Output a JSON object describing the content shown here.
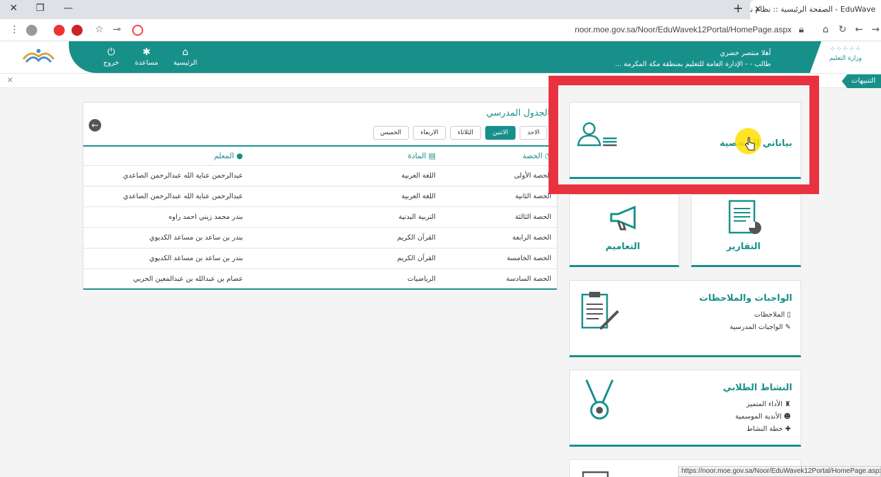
{
  "browser": {
    "tab_title": "EduWave - الصفحة الرئيسية :: نظام نور",
    "url": "noor.moe.gov.sa/Noor/EduWavek12Portal/HomePage.aspx",
    "status_url": "https://noor.moe.gov.sa/Noor/EduWavek12Portal/HomePage.aspx"
  },
  "header": {
    "nav": {
      "home": "الرئيسية",
      "help": "مساعدة",
      "logout": "خروج"
    },
    "welcome": "أهلا منتصر خضري",
    "role_line": "طالب - - الإدارة العامة للتعليم بمنطقة مكة المكرمة ...",
    "ministry": "وزارة التعليم",
    "noor_logo": "NOOR"
  },
  "alerts": {
    "label": "التنبيهات"
  },
  "schedule": {
    "title": "الجدول المدرسي",
    "days": [
      "الاحد",
      "الاثنين",
      "الثلاثاء",
      "الاربعاء",
      "الخميس"
    ],
    "active_day": "الاثنين",
    "columns": {
      "period": "الحصة",
      "subject": "المادة",
      "teacher": "المعلم"
    },
    "rows": [
      {
        "period": "الحصة الأولى",
        "subject": "اللغة العربية",
        "teacher": "عبدالرحمن عناية الله عبدالرحمن الصاعدي"
      },
      {
        "period": "الحصة الثانية",
        "subject": "اللغة العربية",
        "teacher": "عبدالرحمن عناية الله عبدالرحمن الصاعدي"
      },
      {
        "period": "الحصة الثالثة",
        "subject": "التربية البدنية",
        "teacher": "بندر محمد زيني احمد راوه"
      },
      {
        "period": "الحصة الرابعة",
        "subject": "القرآن الكريم",
        "teacher": "بندر بن ساعد بن مساعد الكديوي"
      },
      {
        "period": "الحصة الخامسة",
        "subject": "القرآن الكريم",
        "teacher": "بندر بن ساعد بن مساعد الكديوي"
      },
      {
        "period": "الحصة السادسة",
        "subject": "الرياضيات",
        "teacher": "عصام بن عبدالله بن عبدالمعين الحربي"
      }
    ]
  },
  "cards": {
    "personal": "بياناتي الشخصية",
    "reports": "التقارير",
    "circulars": "التعاميم",
    "homework": {
      "title": "الواجبات والملاحظات",
      "items": [
        "الملاحظات",
        "الواجبات المدرسية"
      ]
    },
    "activity": {
      "title": "النشاط الطلابي",
      "items": [
        "الأداء المتميز",
        "الأندية الموسمية",
        "خطة النشاط"
      ]
    }
  },
  "colors": {
    "brand_teal": "#18908a",
    "highlight_red": "#e8323f"
  }
}
